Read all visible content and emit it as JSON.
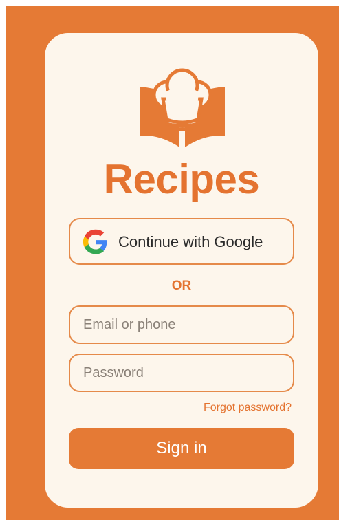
{
  "app": {
    "title": "Recipes"
  },
  "auth": {
    "google_button_label": "Continue with Google",
    "divider_label": "OR",
    "email_placeholder": "Email or phone",
    "password_placeholder": "Password",
    "forgot_password_label": "Forgot password?",
    "sign_in_label": "Sign in"
  },
  "icons": {
    "logo": "chef-hat-book-icon",
    "google": "google-g-icon"
  },
  "colors": {
    "brand_orange": "#e57a35",
    "card_background": "#fdf6ec",
    "text_dark": "#2b2b2b",
    "placeholder_gray": "#8a8178"
  }
}
